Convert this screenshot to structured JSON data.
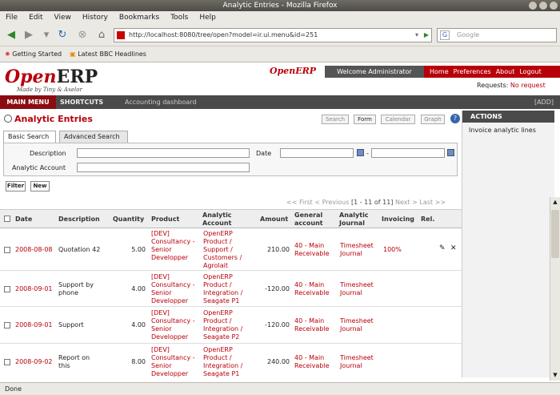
{
  "window": {
    "title": "Analytic Entries - Mozilla Firefox"
  },
  "browser_menu": [
    "File",
    "Edit",
    "View",
    "History",
    "Bookmarks",
    "Tools",
    "Help"
  ],
  "url": "http://localhost:8080/tree/open?model=ir.ui.menu&id=251",
  "search_placeholder": "Google",
  "bookmarks": [
    "Getting Started",
    "Latest BBC Headlines"
  ],
  "header": {
    "logo_open": "Open",
    "logo_erp": "ERP",
    "logo_sub": "Made by Tiny & Axelor",
    "mini_logo": "OpenERP",
    "welcome": "Welcome Administrator",
    "links": [
      "Home",
      "Preferences",
      "About",
      "Logout"
    ],
    "requests_label": "Requests:",
    "requests_value": "No request"
  },
  "mainnav": {
    "main_menu": "MAIN MENU",
    "shortcuts": "SHORTCUTS",
    "active": "Accounting dashboard",
    "add": "[ADD]"
  },
  "page": {
    "title": "Analytic Entries",
    "toolbar": [
      "Search",
      "Form",
      "Calendar",
      "Graph"
    ]
  },
  "sidebar": {
    "header": "ACTIONS",
    "items": [
      "Invoice analytic lines"
    ]
  },
  "search": {
    "tabs": [
      "Basic Search",
      "Advanced Search"
    ],
    "fields": {
      "description": "Description",
      "date": "Date",
      "account": "Analytic Account"
    },
    "date_sep": "-",
    "filter": "Filter",
    "new": "New"
  },
  "pager": {
    "first": "<< First",
    "prev": "< Previous",
    "count": "[1 - 11 of 11]",
    "next": "Next >",
    "last": "Last >>"
  },
  "table": {
    "columns": [
      "Date",
      "Description",
      "Quantity",
      "Product",
      "Analytic Account",
      "Amount",
      "General account",
      "Analytic Journal",
      "Invoicing",
      "Rel."
    ],
    "rows": [
      {
        "date": "2008-08-08",
        "desc": "Quotation 42",
        "qty": "5.00",
        "product": "[DEV] Consultancy - Senior Developper",
        "account": "OpenERP Product / Support / Customers / Agrolait",
        "amount": "210.00",
        "general": "40 - Main Receivable",
        "journal": "Timesheet Journal",
        "invoicing": "100%"
      },
      {
        "date": "2008-09-01",
        "desc": "Support by phone",
        "qty": "4.00",
        "product": "[DEV] Consultancy - Senior Developper",
        "account": "OpenERP Product / Integration / Seagate P1",
        "amount": "-120.00",
        "general": "40 - Main Receivable",
        "journal": "Timesheet Journal",
        "invoicing": ""
      },
      {
        "date": "2008-09-01",
        "desc": "Support",
        "qty": "4.00",
        "product": "[DEV] Consultancy - Senior Developper",
        "account": "OpenERP Product / Integration / Seagate P2",
        "amount": "-120.00",
        "general": "40 - Main Receivable",
        "journal": "Timesheet Journal",
        "invoicing": ""
      },
      {
        "date": "2008-09-02",
        "desc": "Report on this",
        "qty": "8.00",
        "product": "[DEV] Consultancy - Senior Developper",
        "account": "OpenERP Product / Integration / Seagate P1",
        "amount": "240.00",
        "general": "40 - Main Receivable",
        "journal": "Timesheet Journal",
        "invoicing": ""
      }
    ]
  },
  "status": "Done"
}
